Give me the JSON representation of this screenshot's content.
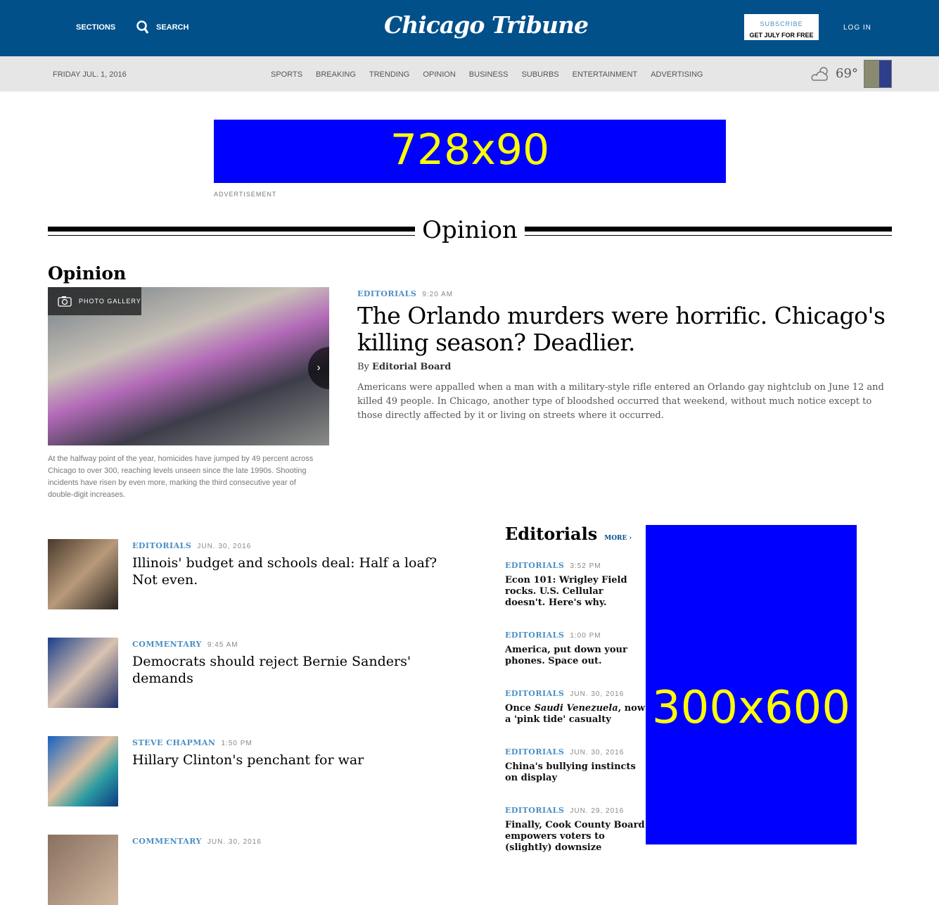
{
  "header": {
    "sections_label": "SECTIONS",
    "search_label": "SEARCH",
    "logo": "Chicago Tribune",
    "subscribe_label": "SUBSCRIBE",
    "subscribe_offer": "GET JULY FOR FREE",
    "login_label": "LOG IN",
    "bg_color": "#01508a"
  },
  "navbar": {
    "date": "FRIDAY JUL. 1, 2016",
    "links": [
      "SPORTS",
      "BREAKING",
      "TRENDING",
      "OPINION",
      "BUSINESS",
      "SUBURBS",
      "ENTERTAINMENT",
      "ADVERTISING"
    ],
    "temperature": "69°",
    "weather_icon": "partly-cloudy-icon"
  },
  "ads": {
    "leaderboard": "728x90",
    "label": "ADVERTISEMENT",
    "skyscraper": "300x600"
  },
  "section_title": "Opinion",
  "lead": {
    "heading": "Opinion",
    "gallery_label": "PHOTO GALLERY",
    "caption": "At the halfway point of the year, homicides have jumped by 49 percent across Chicago to over 300, reaching levels unseen since the late 1990s. Shooting incidents have risen by even more, marking the third consecutive year of double-digit increases.",
    "label": "EDITORIALS",
    "time": "9:20 AM",
    "title": "The Orlando murders were horrific. Chicago's killing season? Deadlier.",
    "by": "By",
    "author": "Editorial Board",
    "summary": "Americans were appalled when a man with a military-style rifle entered an Orlando gay nightclub on June 12 and killed 49 people. In Chicago, another type of bloodshed occurred that weekend, without much notice except to those directly affected by it or living on streets where it occurred."
  },
  "stories": [
    {
      "label": "EDITORIALS",
      "time": "JUN. 30, 2016",
      "title": "Illinois' budget and schools deal: Half a loaf? Not even."
    },
    {
      "label": "COMMENTARY",
      "time": "9:45 AM",
      "title": "Democrats should reject Bernie Sanders' demands"
    },
    {
      "label": "STEVE CHAPMAN",
      "time": "1:50 PM",
      "title": "Hillary Clinton's penchant for war"
    },
    {
      "label": "COMMENTARY",
      "time": "JUN. 30, 2016",
      "title": ""
    }
  ],
  "editorials": {
    "heading": "Editorials",
    "more": "MORE ›",
    "items": [
      {
        "label": "EDITORIALS",
        "time": "3:52 PM",
        "title": "Econ 101: Wrigley Field rocks. U.S. Cellular doesn't. Here's why."
      },
      {
        "label": "EDITORIALS",
        "time": "1:00 PM",
        "title": "America, put down your phones. Space out."
      },
      {
        "label": "EDITORIALS",
        "time": "JUN. 30, 2016",
        "title_pre": "Once ",
        "title_em": "Saudi Venezuela",
        "title_post": ", now a 'pink tide' casualty"
      },
      {
        "label": "EDITORIALS",
        "time": "JUN. 30, 2016",
        "title": "China's bullying instincts on display"
      },
      {
        "label": "EDITORIALS",
        "time": "JUN. 29, 2016",
        "title": "Finally, Cook County Board empowers voters to (slightly) downsize"
      }
    ]
  }
}
